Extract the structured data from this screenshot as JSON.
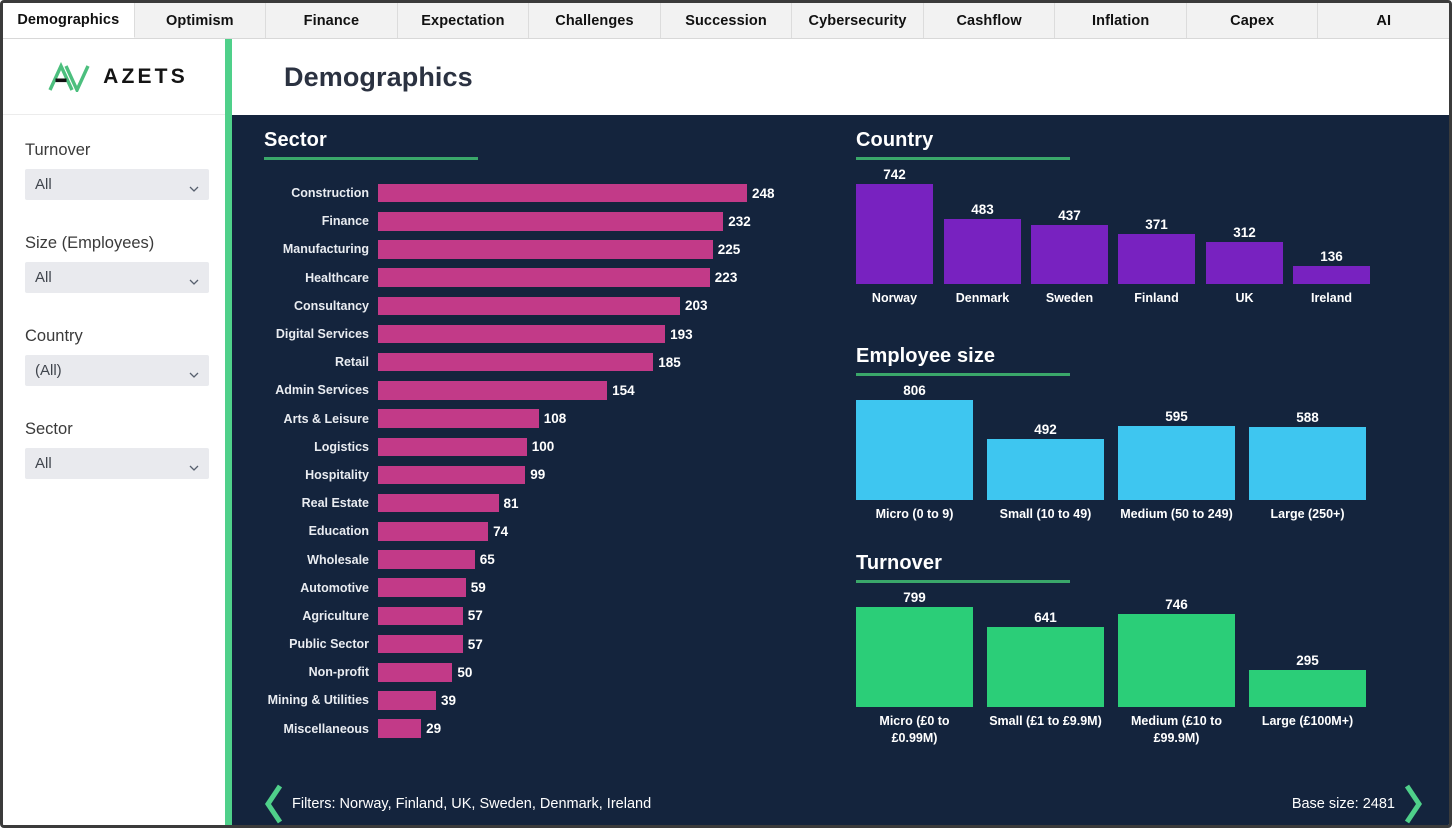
{
  "tabs": [
    {
      "label": "Demographics",
      "active": true
    },
    {
      "label": "Optimism",
      "active": false
    },
    {
      "label": "Finance",
      "active": false
    },
    {
      "label": "Expectation",
      "active": false
    },
    {
      "label": "Challenges",
      "active": false
    },
    {
      "label": "Succession",
      "active": false
    },
    {
      "label": "Cybersecurity",
      "active": false
    },
    {
      "label": "Cashflow",
      "active": false
    },
    {
      "label": "Inflation",
      "active": false
    },
    {
      "label": "Capex",
      "active": false
    },
    {
      "label": "AI",
      "active": false
    }
  ],
  "brand": {
    "name": "AZETS",
    "logo_icon": "azets-logo-icon",
    "accent_green": "#4fd08a"
  },
  "header": {
    "title": "Demographics"
  },
  "sidebar": {
    "filters": [
      {
        "label": "Turnover",
        "value": "All",
        "icon": "chevron-down-icon"
      },
      {
        "label": "Size (Employees)",
        "value": "All",
        "icon": "chevron-down-icon"
      },
      {
        "label": "Country",
        "value": "(All)",
        "icon": "chevron-down-icon"
      },
      {
        "label": "Sector",
        "value": "All",
        "icon": "chevron-down-icon"
      }
    ]
  },
  "footer": {
    "filters_text": "Filters: Norway, Finland, UK, Sweden, Denmark, Ireland",
    "base_size_text": "Base size: 2481",
    "prev_icon": "chevron-left-icon",
    "next_icon": "chevron-right-icon"
  },
  "colors": {
    "canvas_bg": "#14243d",
    "sector_bar": "#c23a88",
    "country_bar": "#7822c0",
    "employee_bar": "#3ec6f0",
    "turnover_bar": "#2bce78",
    "rule_green": "#3aa76a"
  },
  "chart_data": [
    {
      "type": "bar",
      "orientation": "horizontal",
      "title": "Sector",
      "xlabel": "",
      "ylabel": "",
      "grid": false,
      "legend": "none",
      "color": "#c23a88",
      "xlim": [
        0,
        248
      ],
      "categories": [
        "Construction",
        "Finance",
        "Manufacturing",
        "Healthcare",
        "Consultancy",
        "Digital Services",
        "Retail",
        "Admin Services",
        "Arts & Leisure",
        "Logistics",
        "Hospitality",
        "Real Estate",
        "Education",
        "Wholesale",
        "Automotive",
        "Agriculture",
        "Public Sector",
        "Non-profit",
        "Mining & Utilities",
        "Miscellaneous"
      ],
      "values": [
        248,
        232,
        225,
        223,
        203,
        193,
        185,
        154,
        108,
        100,
        99,
        81,
        74,
        65,
        59,
        57,
        57,
        50,
        39,
        29
      ]
    },
    {
      "type": "bar",
      "orientation": "vertical",
      "title": "Country",
      "xlabel": "",
      "ylabel": "",
      "grid": false,
      "legend": "none",
      "color": "#7822c0",
      "ylim": [
        0,
        742
      ],
      "categories": [
        "Norway",
        "Denmark",
        "Sweden",
        "Finland",
        "UK",
        "Ireland"
      ],
      "values": [
        742,
        483,
        437,
        371,
        312,
        136
      ]
    },
    {
      "type": "bar",
      "orientation": "vertical",
      "title": "Employee size",
      "xlabel": "",
      "ylabel": "",
      "grid": false,
      "legend": "none",
      "color": "#3ec6f0",
      "ylim": [
        0,
        806
      ],
      "categories": [
        "Micro (0 to 9)",
        "Small (10 to 49)",
        "Medium (50 to 249)",
        "Large (250+)"
      ],
      "values": [
        806,
        492,
        595,
        588
      ]
    },
    {
      "type": "bar",
      "orientation": "vertical",
      "title": "Turnover",
      "xlabel": "",
      "ylabel": "",
      "grid": false,
      "legend": "none",
      "color": "#2bce78",
      "ylim": [
        0,
        799
      ],
      "categories": [
        "Micro (£0 to £0.99M)",
        "Small (£1 to £9.9M)",
        "Medium (£10 to\n£99.9M)",
        "Large (£100M+)"
      ],
      "values": [
        799,
        641,
        746,
        295
      ]
    }
  ]
}
